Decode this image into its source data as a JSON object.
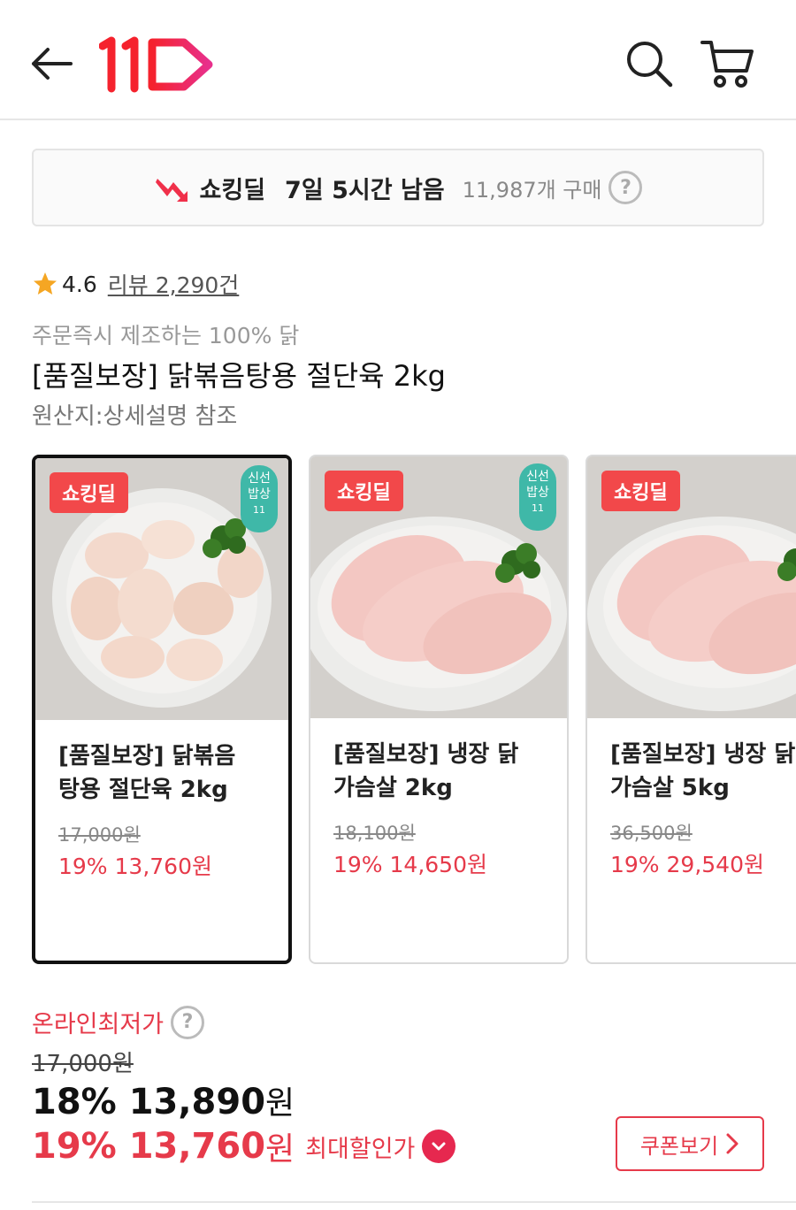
{
  "header": {
    "logo_text": "11",
    "icons": [
      "back-arrow-icon",
      "search-icon",
      "cart-icon"
    ],
    "brand_color": "#f0304a"
  },
  "deal": {
    "title": "쇼킹딜",
    "time_left": "7일 5시간 남음",
    "purchase_count": "11,987개 구매",
    "help": "?"
  },
  "rating": {
    "value": "4.6",
    "reviews": "리뷰 2,290건"
  },
  "product": {
    "subtitle": "주문즉시 제조하는 100% 닭",
    "title": "[품질보장] 닭볶음탕용 절단육 2kg",
    "origin": "원산지:상세설명 참조"
  },
  "options": [
    {
      "badge": "쇼킹딜",
      "fresh_badge": [
        "신선",
        "밥상",
        "11"
      ],
      "name_line1": "[품질보장] 닭볶음",
      "name_line2": "탕용 절단육 2kg",
      "original_price": "17,000원",
      "discount_price": "19% 13,760원",
      "selected": true
    },
    {
      "badge": "쇼킹딜",
      "fresh_badge": [
        "신선",
        "밥상",
        "11"
      ],
      "name_line1": "[품질보장] 냉장 닭",
      "name_line2": "가슴살 2kg",
      "original_price": "18,100원",
      "discount_price": "19% 14,650원",
      "selected": false
    },
    {
      "badge": "쇼킹딜",
      "name_line1": "[품질보장] 냉장 닭",
      "name_line2": "가슴살 5kg",
      "original_price": "36,500원",
      "discount_price": "19% 29,540원",
      "selected": false
    }
  ],
  "pricing": {
    "lowest_label": "온라인최저가",
    "help": "?",
    "original_price": "17,000원",
    "sale_percent": "18%",
    "sale_amount": "13,890",
    "max_percent": "19%",
    "max_amount": "13,760",
    "won": "원",
    "max_label": "최대할인가",
    "coupon_button": "쿠폰보기",
    "accent_color": "#e63a4a"
  }
}
